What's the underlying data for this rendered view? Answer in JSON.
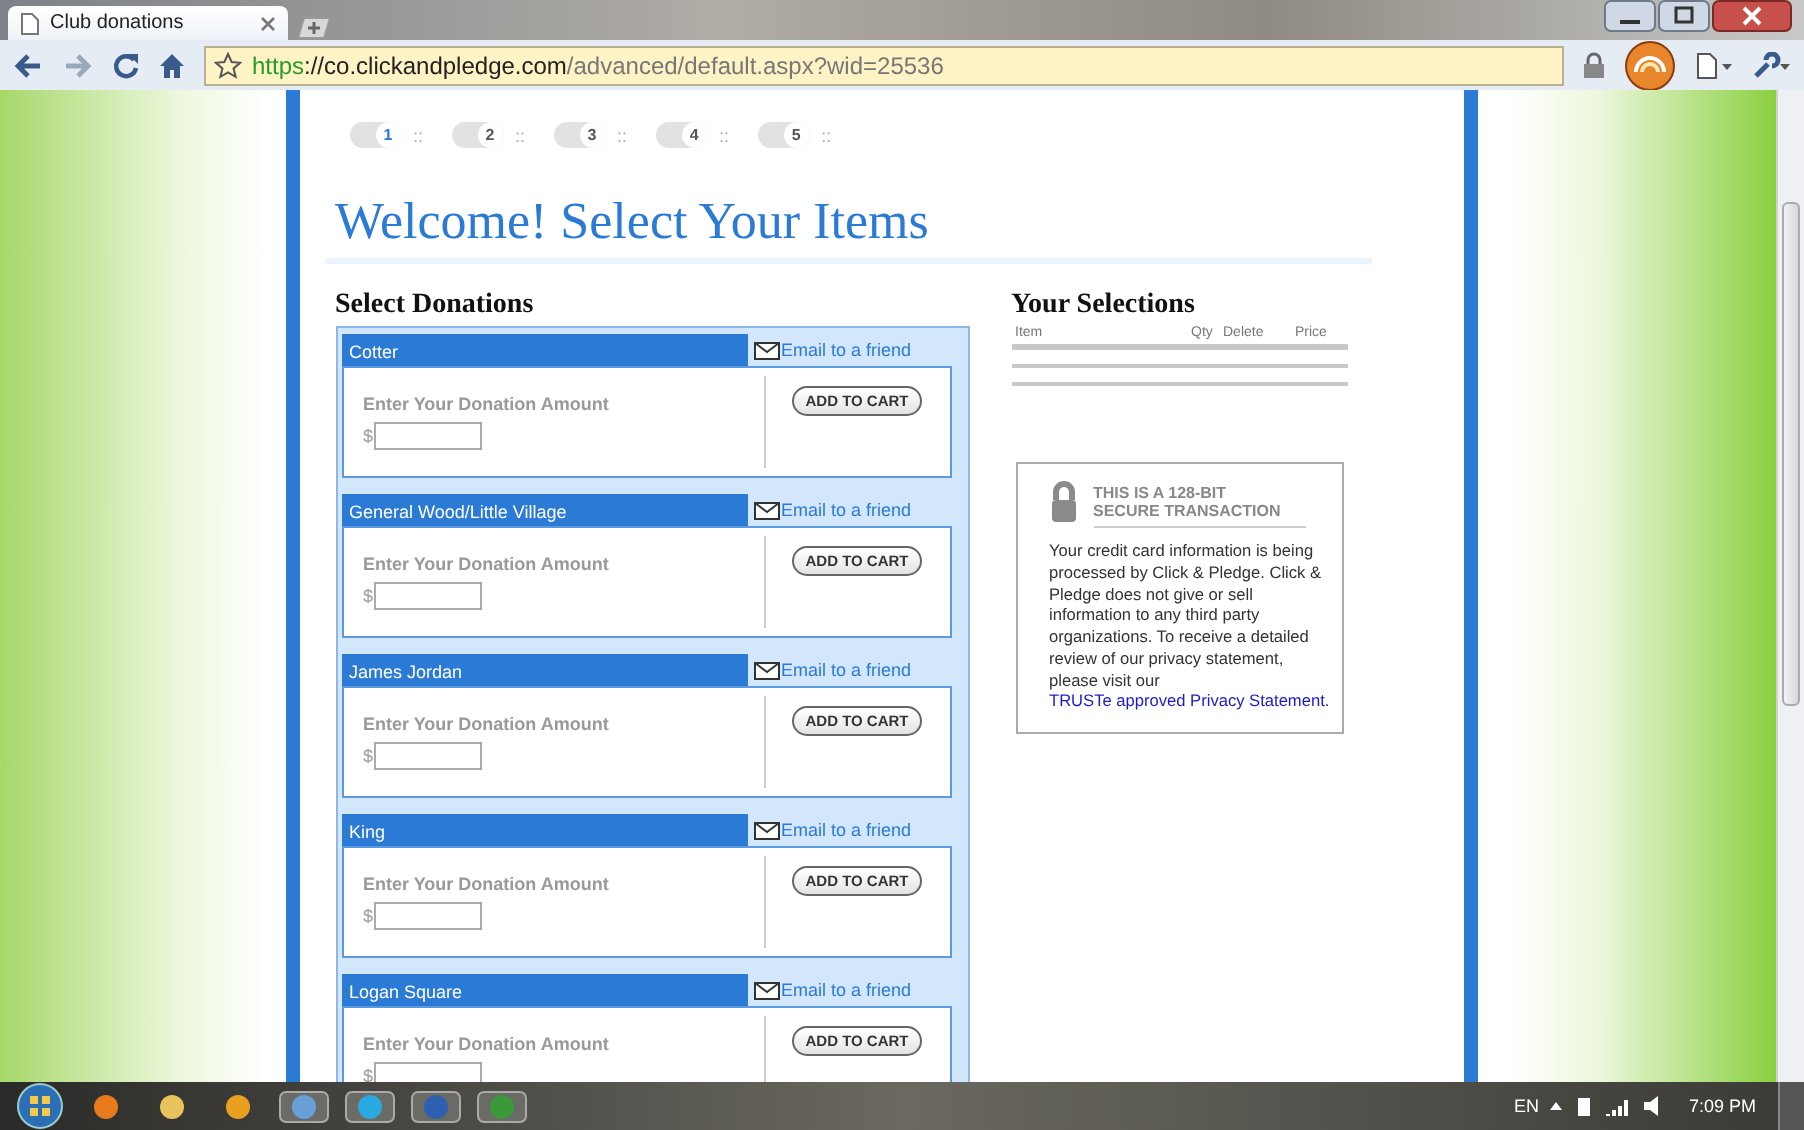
{
  "browser": {
    "tab_title": "Club donations",
    "url": {
      "scheme": "https",
      "host": "://co.clickandpledge.com",
      "path": "/advanced/default.aspx?wid=25536"
    }
  },
  "steps": [
    {
      "label": "1",
      "separator": "::",
      "selected": true
    },
    {
      "label": "2",
      "separator": "::",
      "selected": false
    },
    {
      "label": "3",
      "separator": "::",
      "selected": false
    },
    {
      "label": "4",
      "separator": "::",
      "selected": false
    },
    {
      "label": "5",
      "separator": "::",
      "selected": false
    }
  ],
  "heading": "Welcome! Select Your Items",
  "donations": {
    "title": "Select Donations",
    "items": [
      {
        "name": "Cotter",
        "email_link": "Email to a friend",
        "amount_label": "Enter Your Donation Amount",
        "currency": "$",
        "button": "ADD TO CART"
      },
      {
        "name": "General Wood/Little Village",
        "email_link": "Email to a friend",
        "amount_label": "Enter Your Donation Amount",
        "currency": "$",
        "button": "ADD TO CART"
      },
      {
        "name": "James Jordan",
        "email_link": "Email to a friend",
        "amount_label": "Enter Your Donation Amount",
        "currency": "$",
        "button": "ADD TO CART"
      },
      {
        "name": "King",
        "email_link": "Email to a friend",
        "amount_label": "Enter Your Donation Amount",
        "currency": "$",
        "button": "ADD TO CART"
      },
      {
        "name": "Logan Square",
        "email_link": "Email to a friend",
        "amount_label": "Enter Your Donation Amount",
        "currency": "$",
        "button": "ADD TO CART"
      }
    ]
  },
  "selections": {
    "title": "Your Selections",
    "columns": [
      "Item",
      "Qty",
      "Delete",
      "Price"
    ]
  },
  "security": {
    "title": "THIS IS A 128-BIT SECURE TRANSACTION",
    "text": "Your credit card information is being processed by Click & Pledge.  Click & Pledge does not give or sell information to any third party organizations. To receive a detailed review of our privacy statement, please visit our",
    "link": "TRUSTe approved Privacy Statement",
    "after_link": "."
  },
  "taskbar": {
    "language": "EN",
    "time": "7:09 PM"
  }
}
